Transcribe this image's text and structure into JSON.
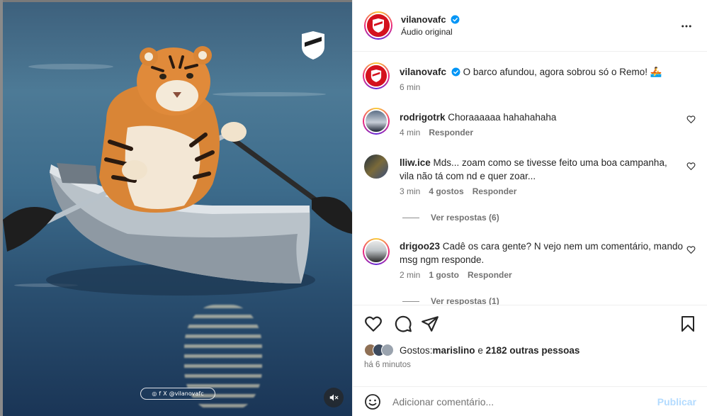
{
  "post": {
    "username": "vilanovafc",
    "audio": "Áudio original",
    "caption_text": "O barco afundou, agora sobrou só o Remo! 🚣",
    "caption_time": "6 min"
  },
  "media": {
    "watermark_handle": "@vilanovafc"
  },
  "comments": [
    {
      "username": "rodrigotrk",
      "text": "Choraaaaaa hahahahaha",
      "time": "4 min",
      "likes": "",
      "reply": "Responder"
    },
    {
      "username": "lliw.ice",
      "text": "Mds... zoam como se tivesse feito uma boa campanha, vila não tá com nd e quer zoar...",
      "time": "3 min",
      "likes": "4 gostos",
      "reply": "Responder",
      "view_replies": "Ver respostas (6)"
    },
    {
      "username": "drigoo23",
      "text": "Cadê os cara gente? N vejo nem um comentário, mando msg ngm responde.",
      "time": "2 min",
      "likes": "1 gosto",
      "reply": "Responder",
      "view_replies": "Ver respostas (1)"
    }
  ],
  "likes": {
    "prefix": "Gostos: ",
    "first_user": "marislino",
    "conjunction": " e ",
    "others": "2182 outras pessoas"
  },
  "posted_ago": "há 6 minutos",
  "add_comment": {
    "placeholder": "Adicionar comentário...",
    "publish_label": "Publicar"
  },
  "colors": {
    "verified": "#0095f6",
    "club_red": "#d4121e",
    "publish_disabled": "#b3dbff"
  },
  "icons": [
    "more-icon",
    "heart-icon",
    "comment-icon",
    "share-icon",
    "bookmark-icon",
    "emoji-icon",
    "mute-icon",
    "verified-icon"
  ]
}
